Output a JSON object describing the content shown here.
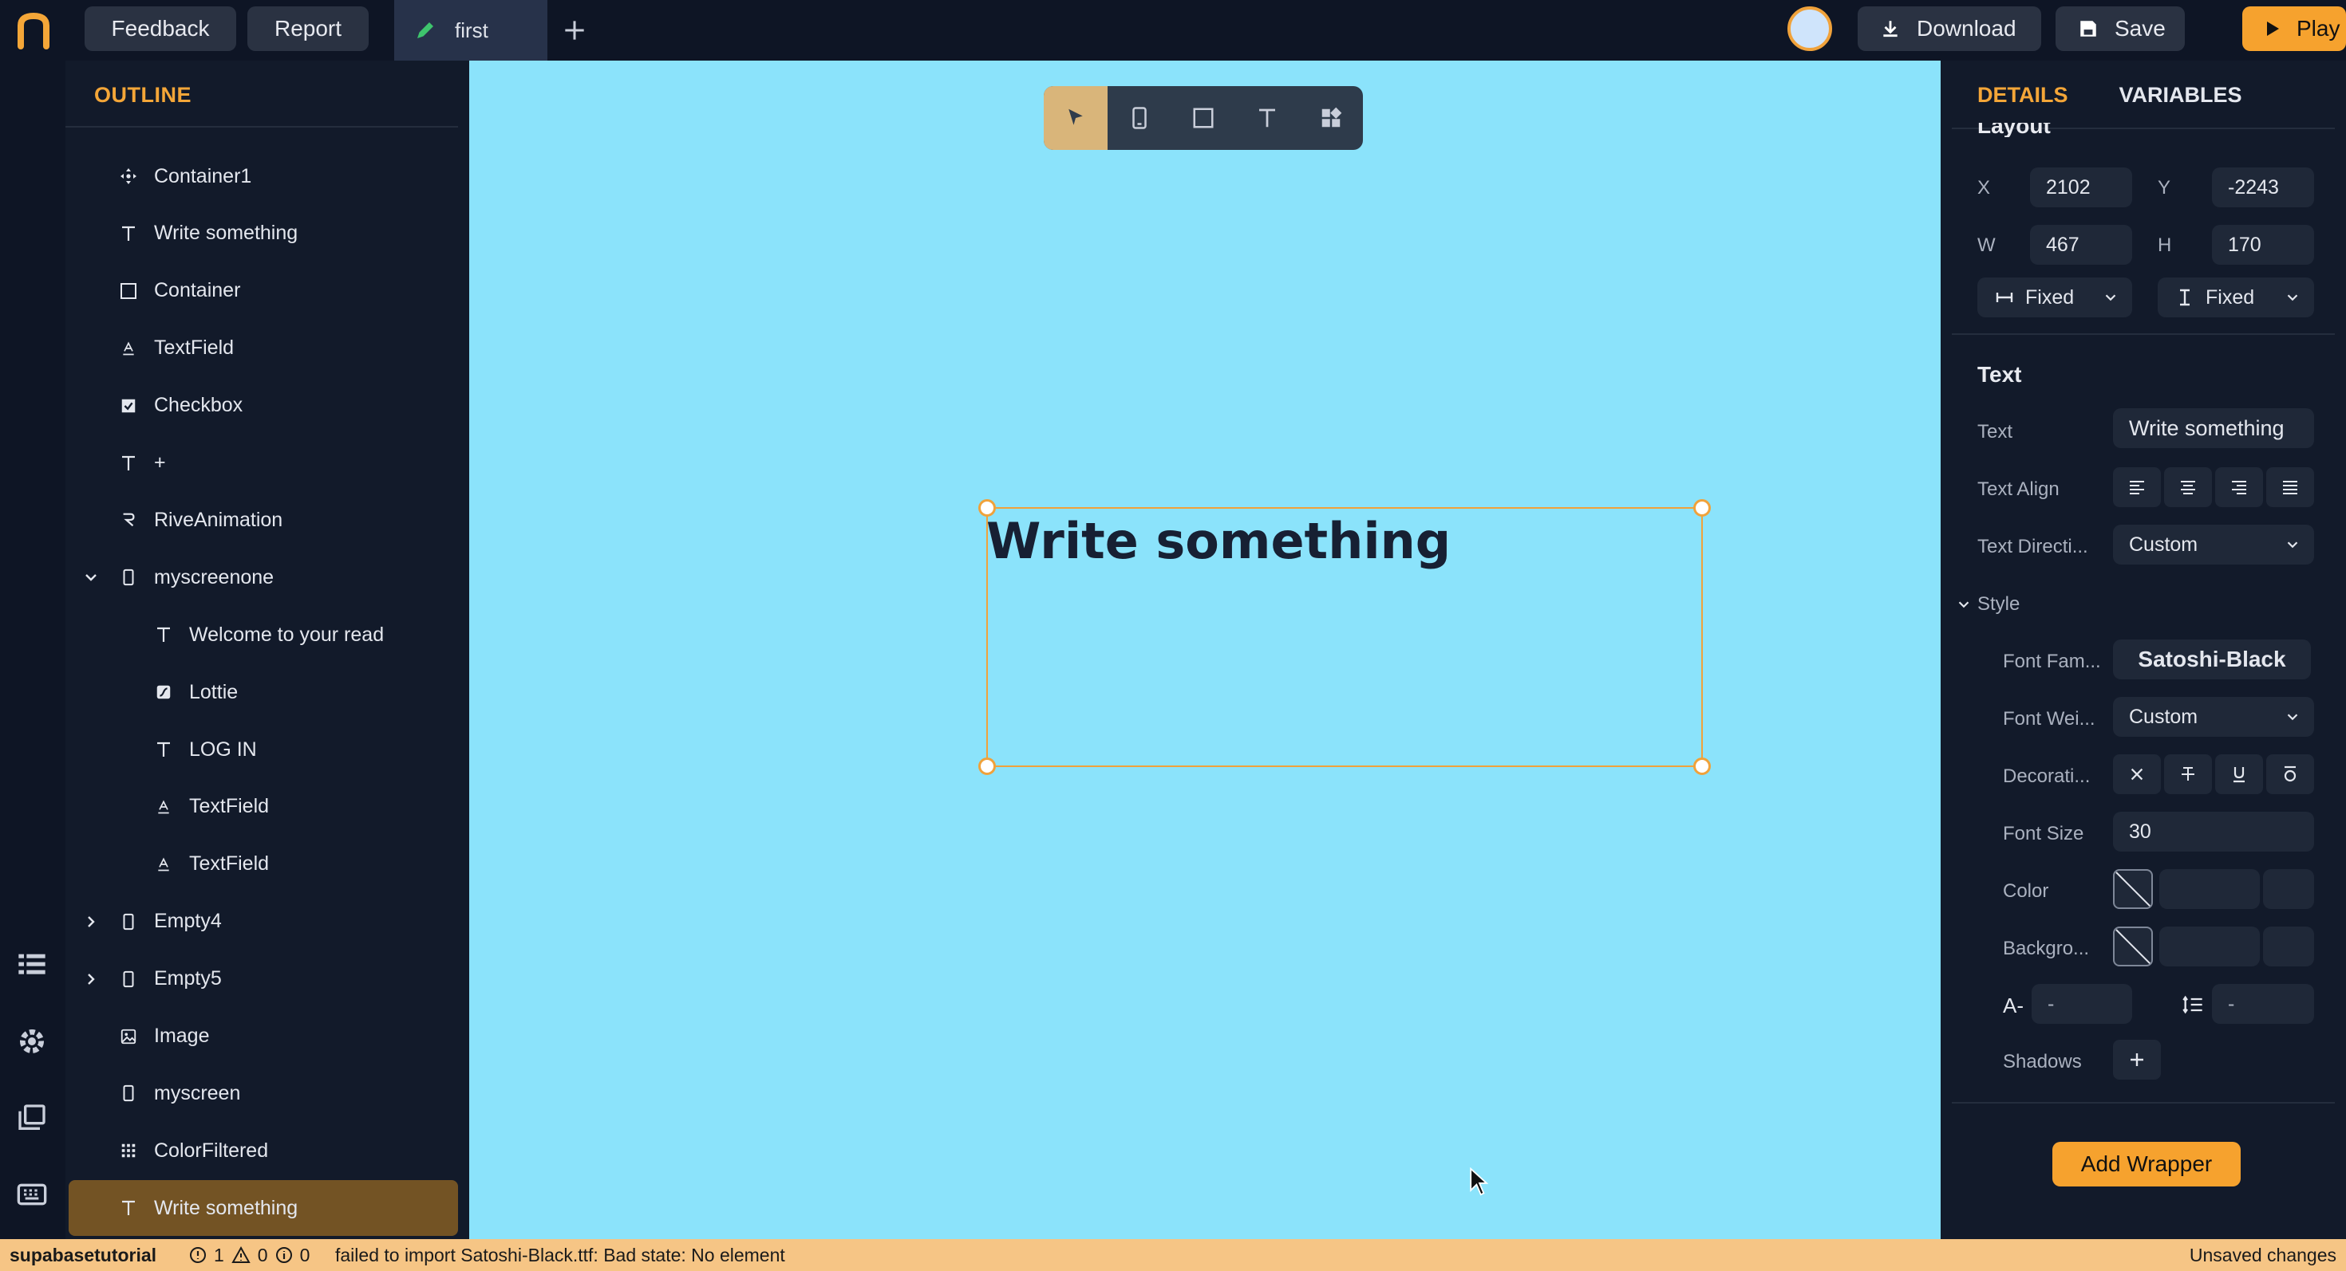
{
  "topbar": {
    "feedback": "Feedback",
    "report": "Report",
    "tab_name": "first",
    "download": "Download",
    "save": "Save",
    "play": "Play"
  },
  "outline": {
    "title": "OUTLINE",
    "items": [
      {
        "label": "Container1",
        "icon": "move-icon"
      },
      {
        "label": "Write something",
        "icon": "text-icon"
      },
      {
        "label": "Container",
        "icon": "square-icon"
      },
      {
        "label": "TextField",
        "icon": "textfield-icon"
      },
      {
        "label": "Checkbox",
        "icon": "checkbox-icon"
      },
      {
        "label": "+",
        "icon": "text-icon"
      },
      {
        "label": "RiveAnimation",
        "icon": "rive-icon"
      },
      {
        "label": "myscreenone",
        "icon": "phone-icon"
      },
      {
        "label": "Welcome to your read",
        "icon": "text-icon"
      },
      {
        "label": "Lottie",
        "icon": "lottie-icon"
      },
      {
        "label": "LOG IN",
        "icon": "text-icon"
      },
      {
        "label": "TextField",
        "icon": "textfield-icon"
      },
      {
        "label": "TextField",
        "icon": "textfield-icon"
      },
      {
        "label": "Empty4",
        "icon": "phone-icon"
      },
      {
        "label": "Empty5",
        "icon": "phone-icon"
      },
      {
        "label": "Image",
        "icon": "image-icon"
      },
      {
        "label": "myscreen",
        "icon": "phone-icon"
      },
      {
        "label": "ColorFiltered",
        "icon": "grid-icon"
      },
      {
        "label": "Write something",
        "icon": "text-icon",
        "selected": true
      }
    ]
  },
  "canvas": {
    "text": "Write something",
    "background": "#8be3fb"
  },
  "details": {
    "tab_details": "DETAILS",
    "tab_variables": "VARIABLES",
    "layout_heading": "Layout",
    "x_label": "X",
    "x_value": "2102",
    "y_label": "Y",
    "y_value": "-2243",
    "w_label": "W",
    "w_value": "467",
    "h_label": "H",
    "h_value": "170",
    "width_mode": "Fixed",
    "height_mode": "Fixed",
    "text_section": "Text",
    "text_label": "Text",
    "text_value": "Write something",
    "align_label": "Text Align",
    "direction_label": "Text Directi...",
    "direction_value": "Custom",
    "style_label": "Style",
    "font_family_label": "Font Fam...",
    "font_family_value": "Satoshi-Black",
    "font_weight_label": "Font Wei...",
    "font_weight_value": "Custom",
    "decoration_label": "Decorati...",
    "font_size_label": "Font Size",
    "font_size_value": "30",
    "color_label": "Color",
    "background_label": "Backgro...",
    "letter_spacing_label": "A-",
    "letter_spacing_value": "-",
    "line_height_value": "-",
    "shadows_label": "Shadows",
    "add_wrapper": "Add Wrapper"
  },
  "statusbar": {
    "project": "supabasetutorial",
    "errors": "1",
    "warnings": "0",
    "infos": "0",
    "message": "failed to import Satoshi-Black.ttf: Bad state: No element",
    "unsaved": "Unsaved changes"
  },
  "colors": {
    "accent": "#f6a22e",
    "selected_row": "#735324",
    "panel": "#121a2a",
    "canvas": "#8be3fb"
  }
}
